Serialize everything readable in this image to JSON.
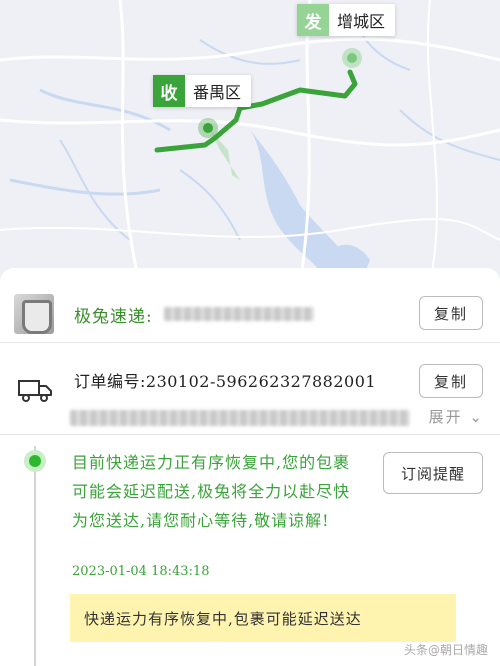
{
  "map": {
    "origin": {
      "tag": "发",
      "label": "增城区"
    },
    "destination": {
      "tag": "收",
      "label": "番禺区"
    },
    "colors": {
      "route": "#3aa33a",
      "origin_tag": "#96d496",
      "dest_tag": "#3aa33a",
      "water": "#c9d9f2"
    }
  },
  "carrier": {
    "label": "极兔速递:",
    "copy_label": "复制",
    "image_icon": "parcel-photo"
  },
  "order": {
    "number_label": "订单编号:230102-596262327882001",
    "copy_label": "复制",
    "expand_label": "展开",
    "icon": "truck-icon"
  },
  "timeline": {
    "status_text": "目前快递运力正有序恢复中,您的包裹可能会延迟配送,极兔将全力以赴尽快为您送达,请您耐心等待,敬请谅解!",
    "timestamp": "2023-01-04 18:43:18",
    "subscribe_label": "订阅提醒",
    "notice": "快递运力有序恢复中,包裹可能延迟送达"
  },
  "watermark": "头条@朝日情趣"
}
